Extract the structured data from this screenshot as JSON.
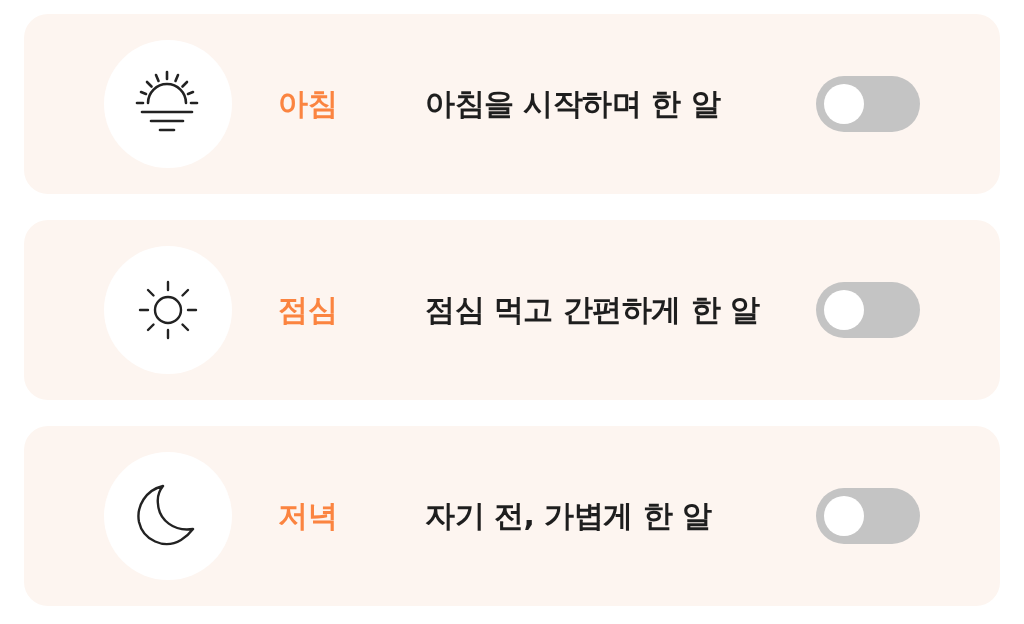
{
  "schedule": [
    {
      "kind": "sunrise",
      "label": "아침",
      "description": "아침을 시작하며 한 알",
      "toggle": {
        "on": false
      }
    },
    {
      "kind": "sun",
      "label": "점심",
      "description": "점심 먹고 간편하게 한 알",
      "toggle": {
        "on": false
      }
    },
    {
      "kind": "moon",
      "label": "저녁",
      "description": "자기 전, 가볍게 한 알",
      "toggle": {
        "on": false
      }
    }
  ]
}
